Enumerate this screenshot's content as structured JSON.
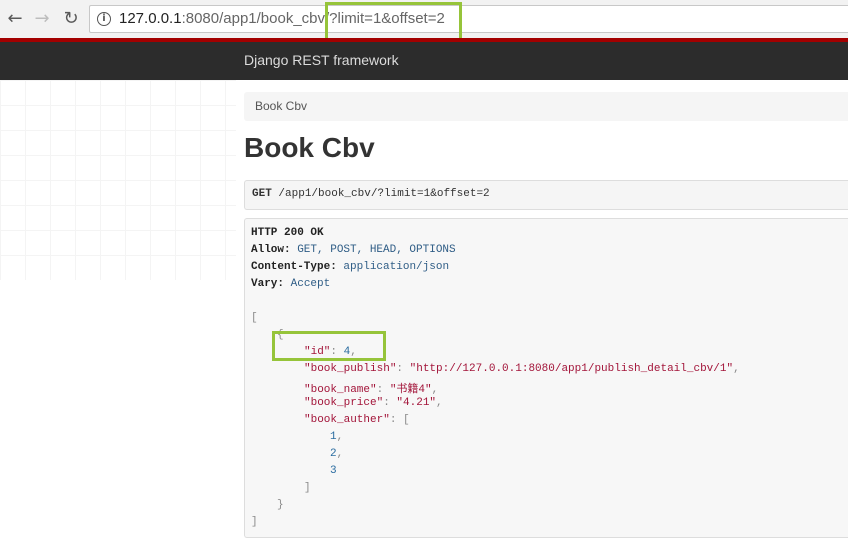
{
  "browser": {
    "url_host": "127.0.0.1",
    "url_rest": ":8080/app1/book_cbv/?limit=1&offset=2"
  },
  "navbar": {
    "brand": "Django REST framework"
  },
  "breadcrumb": {
    "item": "Book Cbv"
  },
  "page": {
    "title": "Book Cbv"
  },
  "request": {
    "method": "GET",
    "path": " /app1/book_cbv/?limit=1&offset=2"
  },
  "response": {
    "status": "HTTP 200 OK",
    "headers": [
      {
        "key": "Allow:",
        "value": " GET, POST, HEAD, OPTIONS"
      },
      {
        "key": "Content-Type:",
        "value": " application/json"
      },
      {
        "key": "Vary:",
        "value": " Accept"
      }
    ],
    "json": {
      "open_bracket": "[",
      "open_brace": "{",
      "id_key": "\"id\"",
      "id_value": "4",
      "book_publish_key": "\"book_publish\"",
      "book_publish_value": "\"http://127.0.0.1:8080/app1/publish_detail_cbv/1\"",
      "book_name_key": "\"book_name\"",
      "book_name_value": "\"书籍4\"",
      "book_price_key": "\"book_price\"",
      "book_price_value": "\"4.21\"",
      "book_auther_key": "\"book_auther\"",
      "book_auther_open": "[",
      "auther_1": "1",
      "auther_2": "2",
      "auther_3": "3",
      "auther_close": "]",
      "close_brace": "}",
      "close_bracket": "]"
    }
  },
  "colors": {
    "highlight": "#96c43a",
    "navbar": "#2c2c2c",
    "redline": "#a30000"
  }
}
